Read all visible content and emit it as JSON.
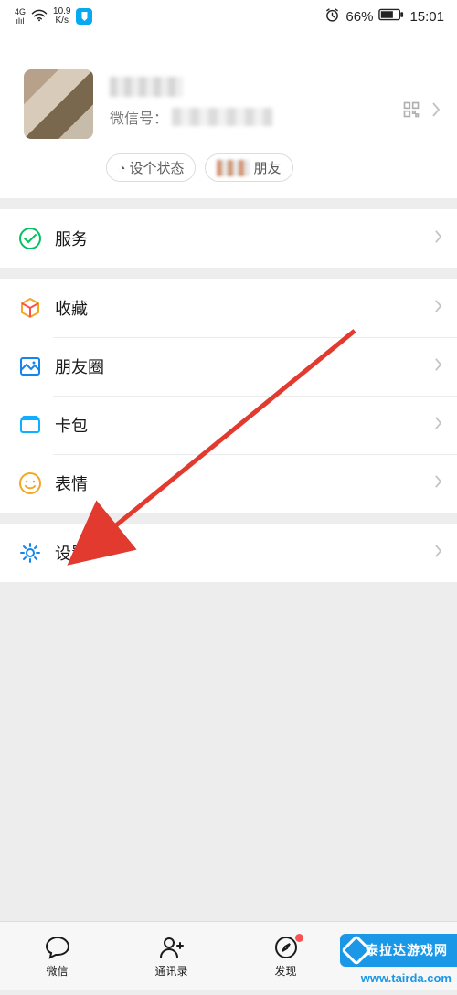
{
  "status_bar": {
    "network_gen": "4G",
    "signal_bars": "ılıl",
    "wifi": "wifi",
    "speed_top": "10.9",
    "speed_bottom": "K/s",
    "alarm_icon": "alarm",
    "battery_pct": "66%",
    "time": "15:01"
  },
  "profile": {
    "wxid_prefix": "微信号：",
    "status_pill": "设个状态",
    "friends_pill_suffix": "朋友"
  },
  "sections": {
    "services": "服务",
    "favorites": "收藏",
    "moments": "朋友圈",
    "cards": "卡包",
    "stickers": "表情",
    "settings": "设置"
  },
  "tabs": {
    "chats": "微信",
    "contacts": "通讯录",
    "discover": "发现",
    "me": ""
  },
  "watermark": {
    "brand": "泰拉达游戏网",
    "url": "www.tairda.com"
  },
  "colors": {
    "arrow": "#e33a2f",
    "accent_green": "#07c160",
    "icon_cyan": "#10aeff",
    "icon_orange": "#f5a623",
    "icon_red": "#fa5151",
    "icon_blue": "#1485ee"
  }
}
